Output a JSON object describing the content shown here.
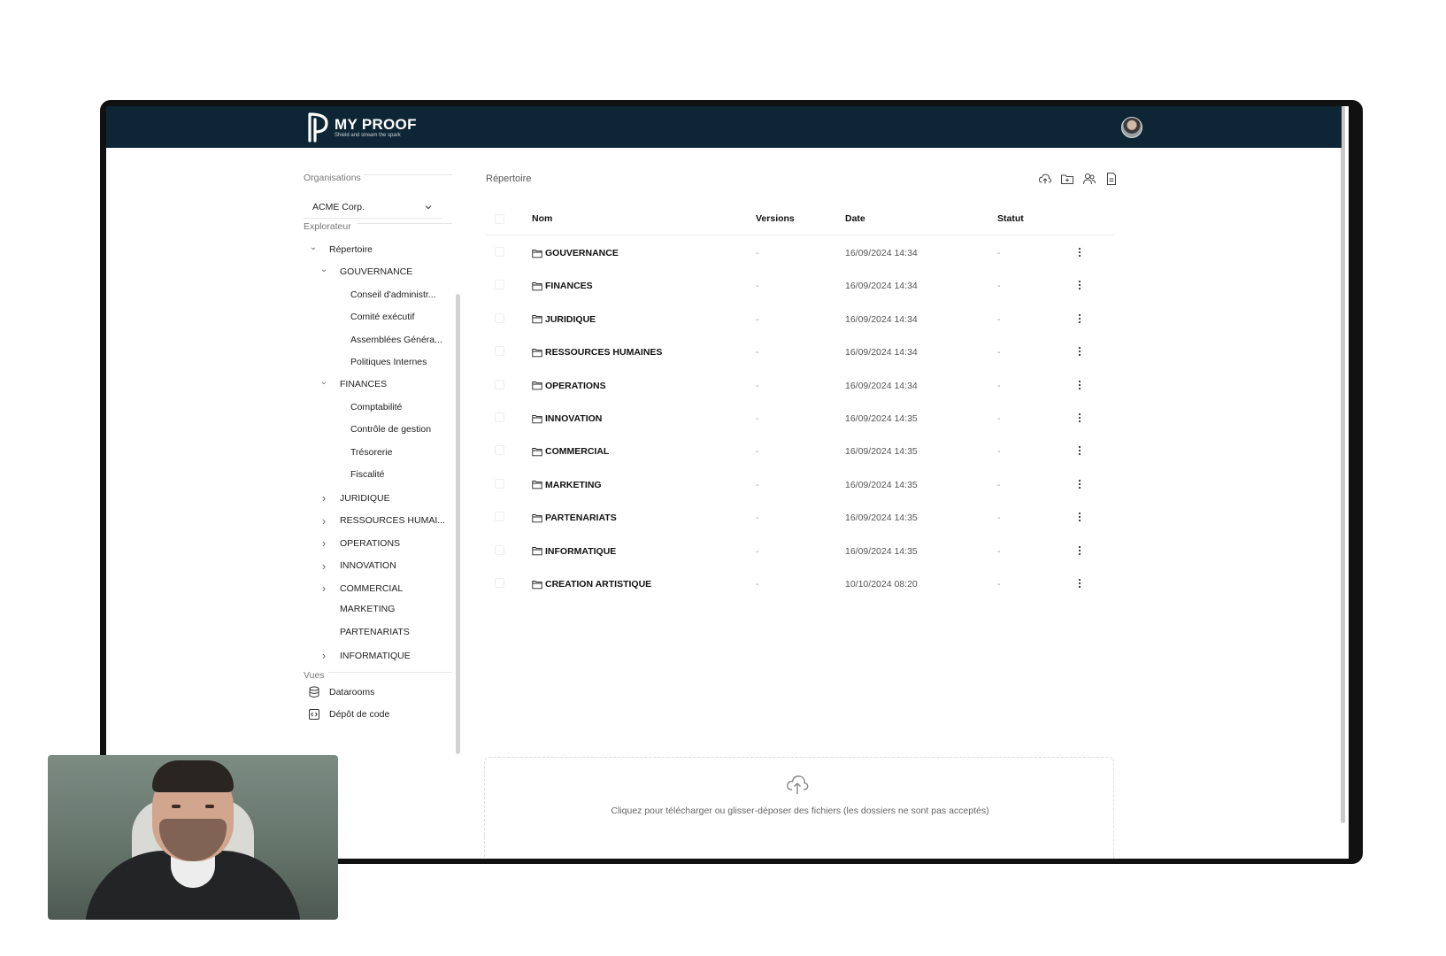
{
  "app": {
    "logo_title": "MY PROOF",
    "logo_subtitle": "Shield and stream the spark",
    "colors": {
      "topbar": "#0e2535",
      "text": "#222222",
      "muted": "#777777"
    }
  },
  "sidebar": {
    "organisations_label": "Organisations",
    "org_selected": "ACME Corp.",
    "explorer_label": "Explorateur",
    "tree": [
      {
        "label": "Répertoire",
        "chevron": "down",
        "level": 0
      },
      {
        "label": "GOUVERNANCE",
        "chevron": "down",
        "level": 1
      },
      {
        "label": "Conseil d'administr...",
        "chevron": "none",
        "level": 2
      },
      {
        "label": "Comité exécutif",
        "chevron": "none",
        "level": 2
      },
      {
        "label": "Assemblées Généra...",
        "chevron": "none",
        "level": 2
      },
      {
        "label": "Politiques Internes",
        "chevron": "none",
        "level": 2
      },
      {
        "label": "FINANCES",
        "chevron": "down",
        "level": 1
      },
      {
        "label": "Comptabilité",
        "chevron": "none",
        "level": 2
      },
      {
        "label": "Contrôle de gestion",
        "chevron": "none",
        "level": 2
      },
      {
        "label": "Trésorerie",
        "chevron": "none",
        "level": 2
      },
      {
        "label": "Fiscalité",
        "chevron": "none",
        "level": 2
      },
      {
        "label": "JURIDIQUE",
        "chevron": "right",
        "level": 1
      },
      {
        "label": "RESSOURCES HUMAI...",
        "chevron": "right",
        "level": 1
      },
      {
        "label": "OPERATIONS",
        "chevron": "right",
        "level": 1
      },
      {
        "label": "INNOVATION",
        "chevron": "right",
        "level": 1
      },
      {
        "label": "COMMERCIAL",
        "chevron": "right",
        "level": 1
      },
      {
        "label": "MARKETING",
        "chevron": "none",
        "level": 1
      },
      {
        "label": "PARTENARIATS",
        "chevron": "none",
        "level": 1
      },
      {
        "label": "INFORMATIQUE",
        "chevron": "right",
        "level": 1
      }
    ],
    "views_label": "Vues",
    "views": [
      {
        "label": "Datarooms",
        "icon": "database-icon"
      },
      {
        "label": "Dépôt de code",
        "icon": "code-file-icon"
      }
    ]
  },
  "main": {
    "title": "Répertoire",
    "toolbar": [
      {
        "name": "upload-cloud-button",
        "icon": "cloud-upload-icon"
      },
      {
        "name": "new-folder-button",
        "icon": "folder-plus-icon"
      },
      {
        "name": "share-users-button",
        "icon": "users-icon"
      },
      {
        "name": "document-button",
        "icon": "document-icon"
      }
    ],
    "columns": {
      "name": "Nom",
      "versions": "Versions",
      "date": "Date",
      "status": "Statut"
    },
    "rows": [
      {
        "name": "GOUVERNANCE",
        "versions": "-",
        "date": "16/09/2024 14:34",
        "status": "-"
      },
      {
        "name": "FINANCES",
        "versions": "-",
        "date": "16/09/2024 14:34",
        "status": "-"
      },
      {
        "name": "JURIDIQUE",
        "versions": "-",
        "date": "16/09/2024 14:34",
        "status": "-"
      },
      {
        "name": "RESSOURCES HUMAINES",
        "versions": "-",
        "date": "16/09/2024 14:34",
        "status": "-"
      },
      {
        "name": "OPERATIONS",
        "versions": "-",
        "date": "16/09/2024 14:34",
        "status": "-"
      },
      {
        "name": "INNOVATION",
        "versions": "-",
        "date": "16/09/2024 14:35",
        "status": "-"
      },
      {
        "name": "COMMERCIAL",
        "versions": "-",
        "date": "16/09/2024 14:35",
        "status": "-"
      },
      {
        "name": "MARKETING",
        "versions": "-",
        "date": "16/09/2024 14:35",
        "status": "-"
      },
      {
        "name": "PARTENARIATS",
        "versions": "-",
        "date": "16/09/2024 14:35",
        "status": "-"
      },
      {
        "name": "INFORMATIQUE",
        "versions": "-",
        "date": "16/09/2024 14:35",
        "status": "-"
      },
      {
        "name": "CREATION ARTISTIQUE",
        "versions": "-",
        "date": "10/10/2024 08:20",
        "status": "-"
      }
    ],
    "dropzone_text": "Cliquez pour télécharger ou glisser-déposer des fichiers (les dossiers ne sont pas acceptés)"
  }
}
